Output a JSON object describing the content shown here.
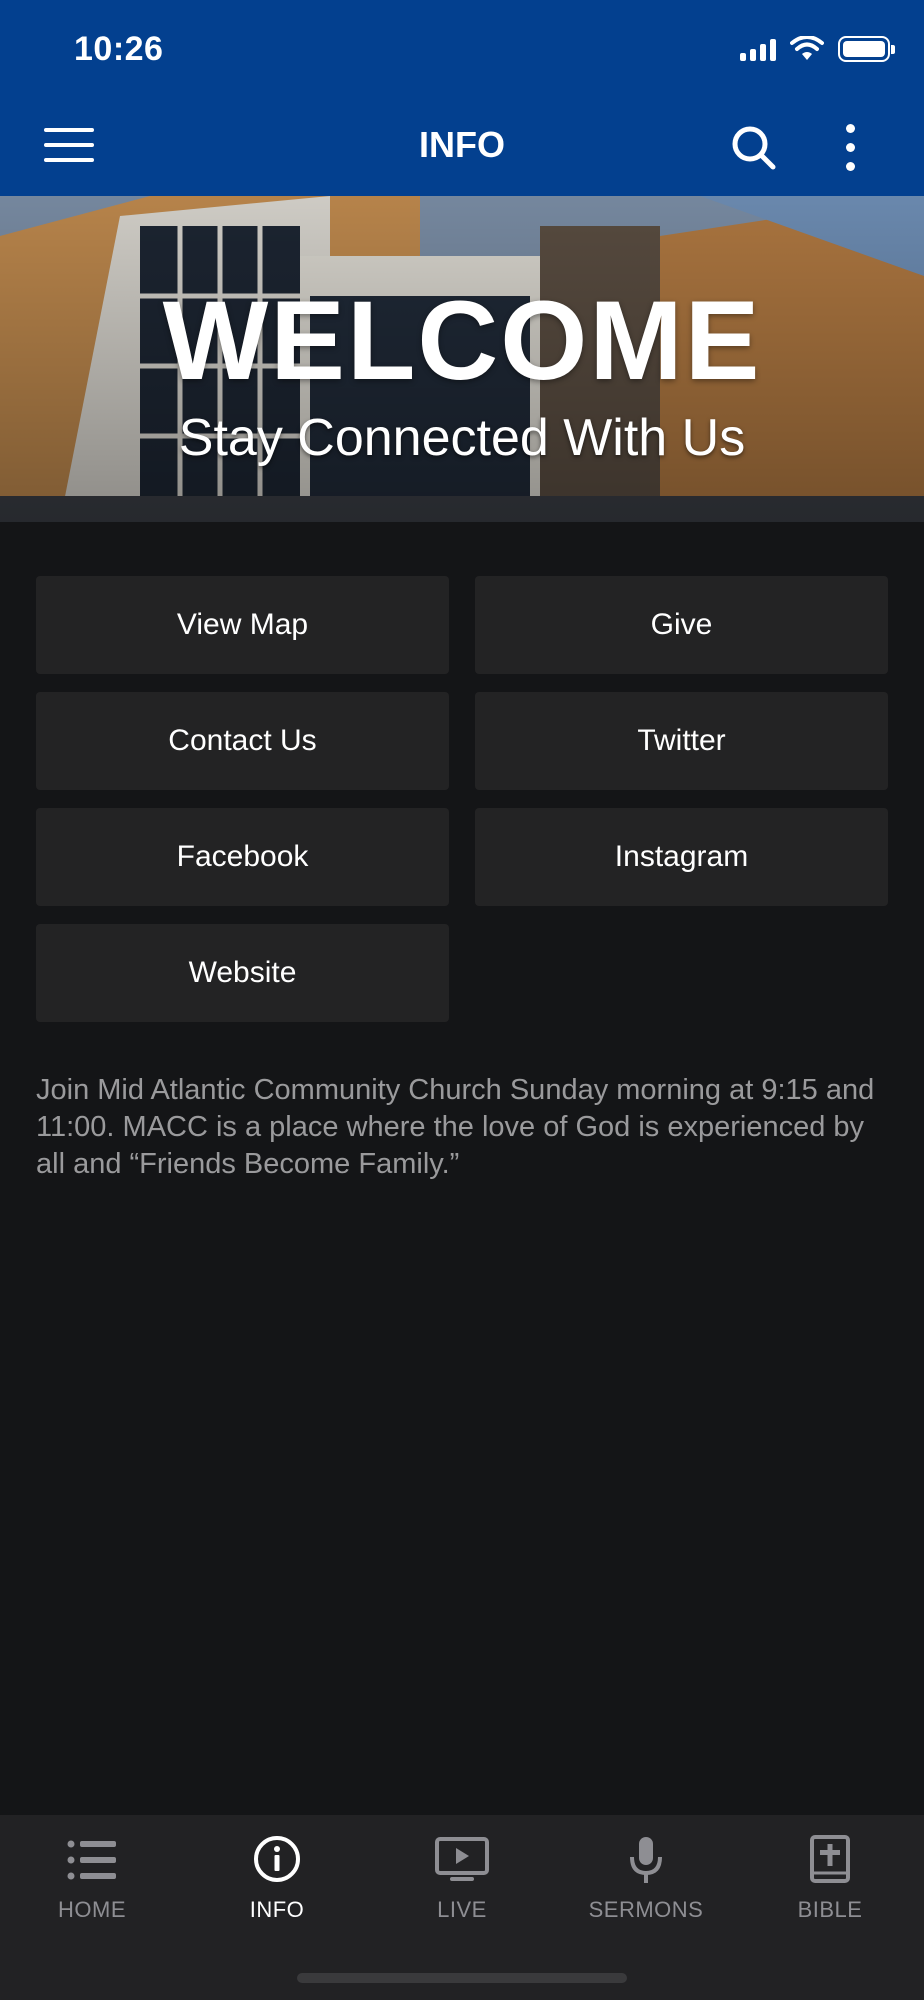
{
  "status_bar": {
    "time": "10:26"
  },
  "app_bar": {
    "title": "INFO"
  },
  "hero": {
    "title": "WELCOME",
    "subtitle": "Stay Connected With Us"
  },
  "buttons": {
    "view_map": "View Map",
    "give": "Give",
    "contact_us": "Contact Us",
    "twitter": "Twitter",
    "facebook": "Facebook",
    "instagram": "Instagram",
    "website": "Website"
  },
  "description": "Join Mid Atlantic Community Church Sunday morning at 9:15 and 11:00.  MACC is a place where the love of God is experienced by all and “Friends Become Family.”",
  "tabs": [
    {
      "label": "HOME",
      "icon": "list-icon",
      "active": false
    },
    {
      "label": "INFO",
      "icon": "info-icon",
      "active": true
    },
    {
      "label": "LIVE",
      "icon": "play-screen-icon",
      "active": false
    },
    {
      "label": "SERMONS",
      "icon": "microphone-icon",
      "active": false
    },
    {
      "label": "BIBLE",
      "icon": "bible-icon",
      "active": false
    }
  ],
  "colors": {
    "app_bar": "#03408f",
    "background": "#141517",
    "button": "#232324",
    "tab_bar": "#222224",
    "tab_active": "#ffffff",
    "tab_inactive": "#8e8e93"
  }
}
